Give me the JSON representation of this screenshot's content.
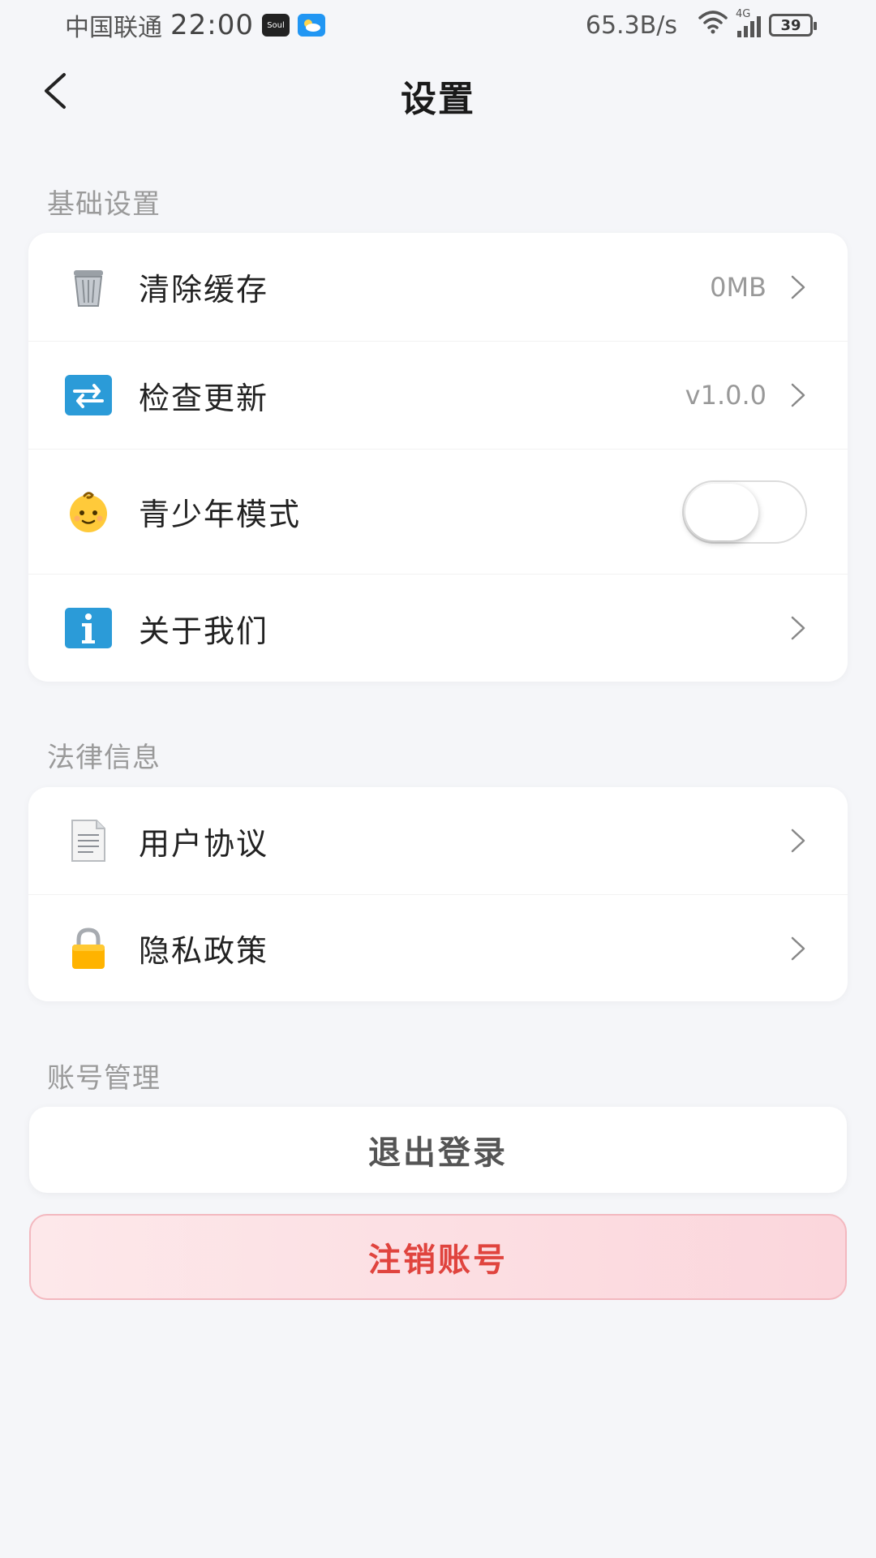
{
  "status_bar": {
    "carrier": "中国联通",
    "time": "22:00",
    "soul_badge": "Soul",
    "net_speed": "65.3B/s",
    "network_type": "4G",
    "battery": "39"
  },
  "header": {
    "title": "设置"
  },
  "sections": {
    "basic": {
      "title": "基础设置",
      "items": [
        {
          "label": "清除缓存",
          "value": "0MB",
          "icon": "trash-can-icon"
        },
        {
          "label": "检查更新",
          "value": "v1.0.0",
          "icon": "refresh-icon"
        },
        {
          "label": "青少年模式",
          "toggle_on": false,
          "icon": "baby-face-icon"
        },
        {
          "label": "关于我们",
          "icon": "info-icon"
        }
      ]
    },
    "legal": {
      "title": "法律信息",
      "items": [
        {
          "label": "用户协议",
          "icon": "document-icon"
        },
        {
          "label": "隐私政策",
          "icon": "lock-icon"
        }
      ]
    },
    "account": {
      "title": "账号管理",
      "logout_label": "退出登录",
      "delete_label": "注销账号"
    }
  },
  "colors": {
    "background": "#f5f6f9",
    "danger_text": "#e0443e",
    "danger_bg": "#fbd6dc",
    "secondary_text": "#999999"
  }
}
